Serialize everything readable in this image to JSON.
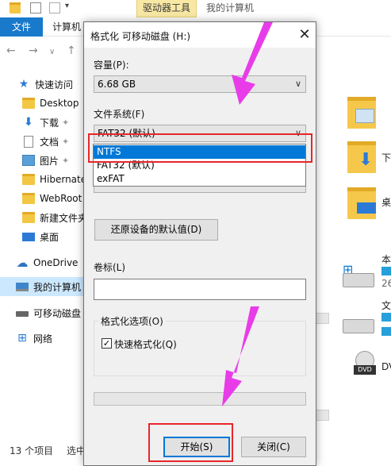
{
  "window": {
    "context_tab": "驱动器工具",
    "title": "我的计算机"
  },
  "menu": {
    "file": "文件",
    "computer": "计算机"
  },
  "sidebar": {
    "items": [
      {
        "label": "快速访问",
        "icon": "star-icon"
      },
      {
        "label": "Desktop",
        "icon": "folder-icon",
        "pinned": true
      },
      {
        "label": "下载",
        "icon": "download-icon",
        "pinned": true
      },
      {
        "label": "文档",
        "icon": "document-icon",
        "pinned": true
      },
      {
        "label": "图片",
        "icon": "picture-icon",
        "pinned": true
      },
      {
        "label": "Hibernate",
        "icon": "folder-icon"
      },
      {
        "label": "WebRoot",
        "icon": "folder-icon"
      },
      {
        "label": "新建文件夹",
        "icon": "folder-icon"
      },
      {
        "label": "桌面",
        "icon": "desktop-icon"
      },
      {
        "label": "OneDrive",
        "icon": "cloud-icon"
      },
      {
        "label": "我的计算机",
        "icon": "computer-icon",
        "selected": true
      },
      {
        "label": "可移动磁盘",
        "icon": "usb-drive-icon"
      },
      {
        "label": "网络",
        "icon": "network-icon"
      }
    ]
  },
  "content_right": {
    "items": [
      "下",
      "桌",
      "本",
      "26",
      "文",
      "DV"
    ]
  },
  "status": {
    "count": "13 个项目",
    "selected": "选中"
  },
  "dialog": {
    "title": "格式化 可移动磁盘 (H:)",
    "capacity_label": "容量(P):",
    "capacity_value": "6.68 GB",
    "filesystem_label": "文件系统(F)",
    "filesystem_value": "FAT32 (默认)",
    "filesystem_options": [
      "NTFS",
      "FAT32 (默认)",
      "exFAT"
    ],
    "filesystem_highlighted": "NTFS",
    "restore_defaults_button": "还原设备的默认值(D)",
    "volume_label": "卷标(L)",
    "volume_value": "",
    "format_options_label": "格式化选项(O)",
    "quick_format_label": "快速格式化(Q)",
    "quick_format_checked": true,
    "progress": 0,
    "start_button": "开始(S)",
    "close_button": "关闭(C)"
  },
  "colors": {
    "accent": "#0078d7",
    "annotation_red": "#e8262a",
    "annotation_arrow": "#e83ce8"
  }
}
